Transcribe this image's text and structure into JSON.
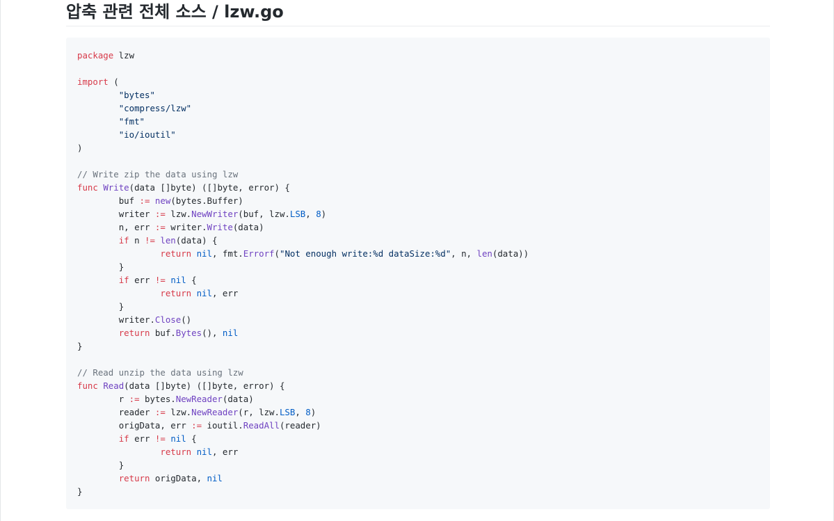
{
  "page": {
    "title": "압축 관련 전체 소스 / lzw.go"
  },
  "code": {
    "language": "go",
    "lines": [
      [
        {
          "t": "kw",
          "v": "package"
        },
        {
          "t": "",
          "v": " lzw"
        }
      ],
      [],
      [
        {
          "t": "kw",
          "v": "import"
        },
        {
          "t": "",
          "v": " ("
        }
      ],
      [
        {
          "t": "",
          "v": "\t"
        },
        {
          "t": "st",
          "v": "\"bytes\""
        }
      ],
      [
        {
          "t": "",
          "v": "\t"
        },
        {
          "t": "st",
          "v": "\"compress/lzw\""
        }
      ],
      [
        {
          "t": "",
          "v": "\t"
        },
        {
          "t": "st",
          "v": "\"fmt\""
        }
      ],
      [
        {
          "t": "",
          "v": "\t"
        },
        {
          "t": "st",
          "v": "\"io/ioutil\""
        }
      ],
      [
        {
          "t": "",
          "v": ")"
        }
      ],
      [],
      [
        {
          "t": "cm",
          "v": "// Write zip the data using lzw"
        }
      ],
      [
        {
          "t": "kw",
          "v": "func"
        },
        {
          "t": "",
          "v": " "
        },
        {
          "t": "fn",
          "v": "Write"
        },
        {
          "t": "",
          "v": "(data []byte) ([]byte, error) {"
        }
      ],
      [
        {
          "t": "",
          "v": "\tbuf "
        },
        {
          "t": "kw",
          "v": ":="
        },
        {
          "t": "",
          "v": " "
        },
        {
          "t": "fn",
          "v": "new"
        },
        {
          "t": "",
          "v": "(bytes.Buffer)"
        }
      ],
      [
        {
          "t": "",
          "v": "\twriter "
        },
        {
          "t": "kw",
          "v": ":="
        },
        {
          "t": "",
          "v": " lzw."
        },
        {
          "t": "fn",
          "v": "NewWriter"
        },
        {
          "t": "",
          "v": "(buf, lzw."
        },
        {
          "t": "cn",
          "v": "LSB"
        },
        {
          "t": "",
          "v": ", "
        },
        {
          "t": "cn",
          "v": "8"
        },
        {
          "t": "",
          "v": ")"
        }
      ],
      [
        {
          "t": "",
          "v": "\tn, err "
        },
        {
          "t": "kw",
          "v": ":="
        },
        {
          "t": "",
          "v": " writer."
        },
        {
          "t": "fn",
          "v": "Write"
        },
        {
          "t": "",
          "v": "(data)"
        }
      ],
      [
        {
          "t": "",
          "v": "\t"
        },
        {
          "t": "kw",
          "v": "if"
        },
        {
          "t": "",
          "v": " n "
        },
        {
          "t": "kw",
          "v": "!="
        },
        {
          "t": "",
          "v": " "
        },
        {
          "t": "fn",
          "v": "len"
        },
        {
          "t": "",
          "v": "(data) {"
        }
      ],
      [
        {
          "t": "",
          "v": "\t\t"
        },
        {
          "t": "kw",
          "v": "return"
        },
        {
          "t": "",
          "v": " "
        },
        {
          "t": "cn",
          "v": "nil"
        },
        {
          "t": "",
          "v": ", fmt."
        },
        {
          "t": "fn",
          "v": "Errorf"
        },
        {
          "t": "",
          "v": "("
        },
        {
          "t": "st",
          "v": "\"Not enough write:%d dataSize:%d\""
        },
        {
          "t": "",
          "v": ", n, "
        },
        {
          "t": "fn",
          "v": "len"
        },
        {
          "t": "",
          "v": "(data))"
        }
      ],
      [
        {
          "t": "",
          "v": "\t}"
        }
      ],
      [
        {
          "t": "",
          "v": "\t"
        },
        {
          "t": "kw",
          "v": "if"
        },
        {
          "t": "",
          "v": " err "
        },
        {
          "t": "kw",
          "v": "!="
        },
        {
          "t": "",
          "v": " "
        },
        {
          "t": "cn",
          "v": "nil"
        },
        {
          "t": "",
          "v": " {"
        }
      ],
      [
        {
          "t": "",
          "v": "\t\t"
        },
        {
          "t": "kw",
          "v": "return"
        },
        {
          "t": "",
          "v": " "
        },
        {
          "t": "cn",
          "v": "nil"
        },
        {
          "t": "",
          "v": ", err"
        }
      ],
      [
        {
          "t": "",
          "v": "\t}"
        }
      ],
      [
        {
          "t": "",
          "v": "\twriter."
        },
        {
          "t": "fn",
          "v": "Close"
        },
        {
          "t": "",
          "v": "()"
        }
      ],
      [
        {
          "t": "",
          "v": "\t"
        },
        {
          "t": "kw",
          "v": "return"
        },
        {
          "t": "",
          "v": " buf."
        },
        {
          "t": "fn",
          "v": "Bytes"
        },
        {
          "t": "",
          "v": "(), "
        },
        {
          "t": "cn",
          "v": "nil"
        }
      ],
      [
        {
          "t": "",
          "v": "}"
        }
      ],
      [],
      [
        {
          "t": "cm",
          "v": "// Read unzip the data using lzw"
        }
      ],
      [
        {
          "t": "kw",
          "v": "func"
        },
        {
          "t": "",
          "v": " "
        },
        {
          "t": "fn",
          "v": "Read"
        },
        {
          "t": "",
          "v": "(data []byte) ([]byte, error) {"
        }
      ],
      [
        {
          "t": "",
          "v": "\tr "
        },
        {
          "t": "kw",
          "v": ":="
        },
        {
          "t": "",
          "v": " bytes."
        },
        {
          "t": "fn",
          "v": "NewReader"
        },
        {
          "t": "",
          "v": "(data)"
        }
      ],
      [
        {
          "t": "",
          "v": "\treader "
        },
        {
          "t": "kw",
          "v": ":="
        },
        {
          "t": "",
          "v": " lzw."
        },
        {
          "t": "fn",
          "v": "NewReader"
        },
        {
          "t": "",
          "v": "(r, lzw."
        },
        {
          "t": "cn",
          "v": "LSB"
        },
        {
          "t": "",
          "v": ", "
        },
        {
          "t": "cn",
          "v": "8"
        },
        {
          "t": "",
          "v": ")"
        }
      ],
      [
        {
          "t": "",
          "v": "\torigData, err "
        },
        {
          "t": "kw",
          "v": ":="
        },
        {
          "t": "",
          "v": " ioutil."
        },
        {
          "t": "fn",
          "v": "ReadAll"
        },
        {
          "t": "",
          "v": "(reader)"
        }
      ],
      [
        {
          "t": "",
          "v": "\t"
        },
        {
          "t": "kw",
          "v": "if"
        },
        {
          "t": "",
          "v": " err "
        },
        {
          "t": "kw",
          "v": "!="
        },
        {
          "t": "",
          "v": " "
        },
        {
          "t": "cn",
          "v": "nil"
        },
        {
          "t": "",
          "v": " {"
        }
      ],
      [
        {
          "t": "",
          "v": "\t\t"
        },
        {
          "t": "kw",
          "v": "return"
        },
        {
          "t": "",
          "v": " "
        },
        {
          "t": "cn",
          "v": "nil"
        },
        {
          "t": "",
          "v": ", err"
        }
      ],
      [
        {
          "t": "",
          "v": "\t}"
        }
      ],
      [
        {
          "t": "",
          "v": "\t"
        },
        {
          "t": "kw",
          "v": "return"
        },
        {
          "t": "",
          "v": " origData, "
        },
        {
          "t": "cn",
          "v": "nil"
        }
      ],
      [
        {
          "t": "",
          "v": "}"
        }
      ]
    ]
  },
  "colors": {
    "keyword": "#d73a49",
    "comment": "#6a737d",
    "function": "#6f42c1",
    "constant": "#005cc5",
    "string": "#032f62",
    "code_background": "#f6f8fa"
  }
}
